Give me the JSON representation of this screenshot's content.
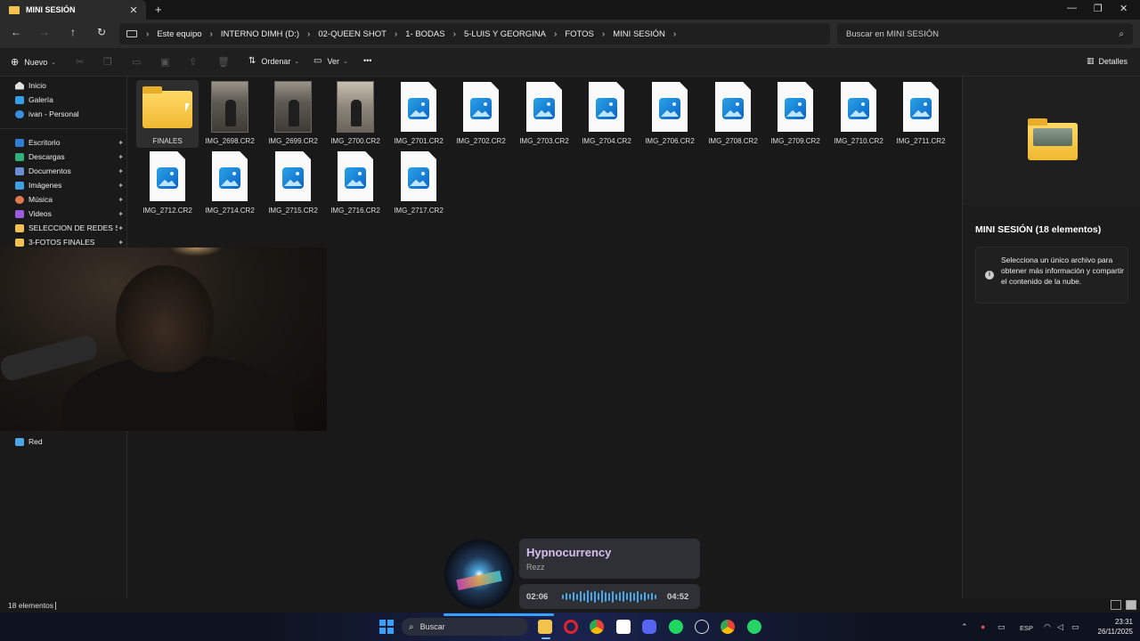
{
  "window": {
    "tab_title": "MINI SESIÓN",
    "close_glyph": "✕",
    "newtab_glyph": "+",
    "minimize_glyph": "—",
    "maximize_glyph": "❐",
    "closewin_glyph": "✕"
  },
  "address": {
    "breadcrumbs": [
      "Este equipo",
      "INTERNO  DIMH (D:)",
      "02-QUEEN SHOT",
      "1- BODAS",
      "5-LUIS Y GEORGINA",
      "FOTOS",
      "MINI SESIÓN"
    ],
    "search_placeholder": "Buscar en MINI SESIÓN"
  },
  "toolbar": {
    "new_label": "Nuevo",
    "sort_label": "Ordenar",
    "view_label": "Ver",
    "more_label": "•••",
    "details_label": "Detalles"
  },
  "sidebar": {
    "items": [
      {
        "label": "Inicio",
        "icon": "home-icon",
        "color": "#e0e0e0"
      },
      {
        "label": "Galería",
        "icon": "gallery-icon",
        "color": "#34a0e8"
      },
      {
        "label": "ivan - Personal",
        "icon": "cloud-icon",
        "color": "#3a8fe0"
      },
      {
        "label": "Escritorio",
        "icon": "desktop-icon",
        "color": "#2f7fd8",
        "pinned": true
      },
      {
        "label": "Descargas",
        "icon": "download-icon",
        "color": "#2fb27a",
        "pinned": true
      },
      {
        "label": "Documentos",
        "icon": "documents-icon",
        "color": "#6b8fd6",
        "pinned": true
      },
      {
        "label": "Imágenes",
        "icon": "pictures-icon",
        "color": "#3ba0e6",
        "pinned": true
      },
      {
        "label": "Música",
        "icon": "music-icon",
        "color": "#e07a4e",
        "pinned": true
      },
      {
        "label": "Videos",
        "icon": "videos-icon",
        "color": "#9b5ae0",
        "pinned": true
      },
      {
        "label": "SELECCION DE REDES SOCIA",
        "icon": "folder-icon",
        "color": "#f2c14e",
        "pinned": true
      },
      {
        "label": "3-FOTOS FINALES",
        "icon": "folder-icon",
        "color": "#f2c14e",
        "pinned": true
      }
    ],
    "network_label": "Red"
  },
  "files": [
    {
      "name": "FINALES",
      "kind": "folder"
    },
    {
      "name": "IMG_2698.CR2",
      "kind": "photo"
    },
    {
      "name": "IMG_2699.CR2",
      "kind": "photo"
    },
    {
      "name": "IMG_2700.CR2",
      "kind": "photo"
    },
    {
      "name": "IMG_2701.CR2",
      "kind": "image"
    },
    {
      "name": "IMG_2702.CR2",
      "kind": "image"
    },
    {
      "name": "IMG_2703.CR2",
      "kind": "image"
    },
    {
      "name": "IMG_2704.CR2",
      "kind": "image"
    },
    {
      "name": "IMG_2706.CR2",
      "kind": "image"
    },
    {
      "name": "IMG_2708.CR2",
      "kind": "image"
    },
    {
      "name": "IMG_2709.CR2",
      "kind": "image"
    },
    {
      "name": "IMG_2710.CR2",
      "kind": "image"
    },
    {
      "name": "IMG_2711.CR2",
      "kind": "image"
    },
    {
      "name": "IMG_2712.CR2",
      "kind": "image"
    },
    {
      "name": "IMG_2714.CR2",
      "kind": "image"
    },
    {
      "name": "IMG_2715.CR2",
      "kind": "image"
    },
    {
      "name": "IMG_2716.CR2",
      "kind": "image"
    },
    {
      "name": "IMG_2717.CR2",
      "kind": "image"
    }
  ],
  "details": {
    "title": "MINI SESIÓN (18 elementos)",
    "info": "Selecciona un único archivo para obtener más información y compartir el contenido de la nube."
  },
  "status": {
    "count": "18 elementos"
  },
  "music": {
    "title": "Hypnocurrency",
    "artist": "Rezz",
    "elapsed": "02:06",
    "total": "04:52"
  },
  "taskbar": {
    "search_label": "Buscar",
    "language": "ESP",
    "time": "23:31",
    "date": "26/11/2025"
  }
}
